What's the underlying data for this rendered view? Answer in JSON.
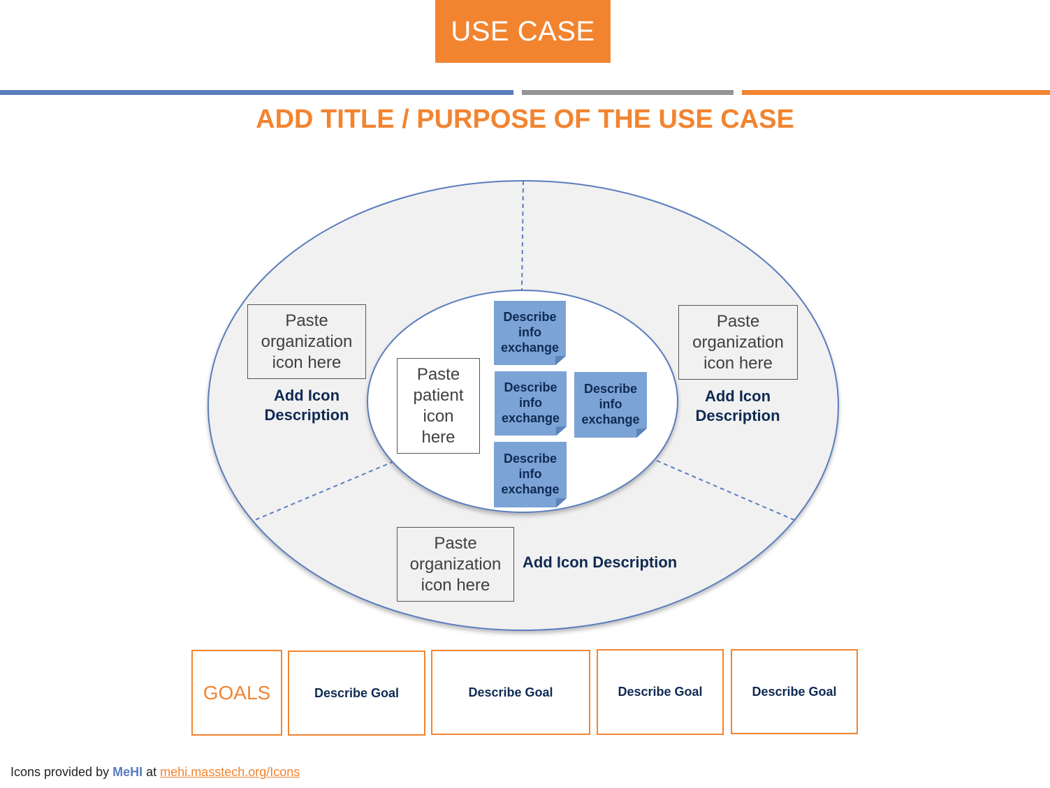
{
  "header": {
    "badge_label": "USE CASE"
  },
  "colors": {
    "accent_orange": "#F28430",
    "accent_blue": "#5A7DBD",
    "accent_gray": "#949494",
    "note_blue": "#7BA3D6",
    "text_navy": "#0F2A52"
  },
  "title": "ADD TITLE / PURPOSE OF THE USE CASE",
  "diagram": {
    "organizations": [
      {
        "placeholder": "Paste organization icon here",
        "description": "Add Icon Description",
        "position": "left"
      },
      {
        "placeholder": "Paste organization icon here",
        "description": "Add Icon Description",
        "position": "right"
      },
      {
        "placeholder": "Paste organization icon here",
        "description": "Add Icon Description",
        "position": "bottom"
      }
    ],
    "patient": {
      "placeholder": "Paste patient icon here"
    },
    "info_exchanges": [
      {
        "label": "Describe info exchange"
      },
      {
        "label": "Describe info exchange"
      },
      {
        "label": "Describe info exchange"
      },
      {
        "label": "Describe info exchange"
      }
    ]
  },
  "goals": {
    "label": "GOALS",
    "items": [
      {
        "label": "Describe Goal"
      },
      {
        "label": "Describe Goal"
      },
      {
        "label": "Describe Goal"
      },
      {
        "label": "Describe Goal"
      }
    ]
  },
  "footer": {
    "prefix": "Icons provided by",
    "brand": "MeHI",
    "middle": "at",
    "link_text": "mehi.masstech.org/Icons"
  }
}
